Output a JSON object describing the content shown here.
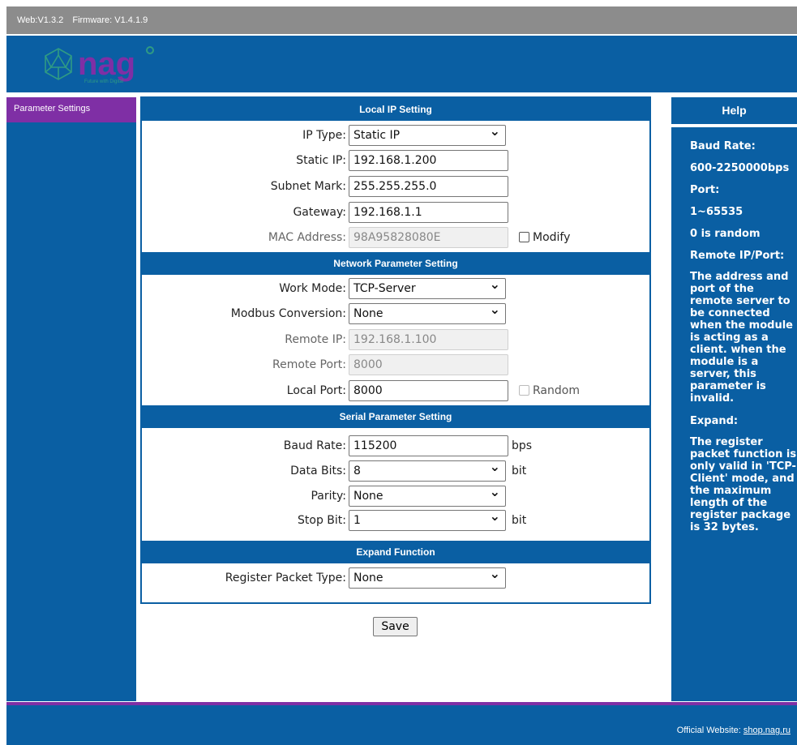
{
  "topbar": {
    "web_version": "Web:V1.3.2",
    "firmware_version": "Firmware: V1.4.1.9"
  },
  "logo": {
    "text": "nag",
    "tagline": "Future with Digital"
  },
  "sidebar": {
    "items": [
      {
        "label": "Parameter Settings"
      }
    ]
  },
  "local_ip": {
    "title": "Local IP Setting",
    "ip_type_label": "IP Type:",
    "ip_type_value": "Static IP",
    "static_ip_label": "Static IP:",
    "static_ip_value": "192.168.1.200",
    "subnet_label": "Subnet Mark:",
    "subnet_value": "255.255.255.0",
    "gateway_label": "Gateway:",
    "gateway_value": "192.168.1.1",
    "mac_label": "MAC Address:",
    "mac_value": "98A95828080E",
    "modify_label": "Modify"
  },
  "network": {
    "title": "Network Parameter Setting",
    "work_mode_label": "Work Mode:",
    "work_mode_value": "TCP-Server",
    "modbus_label": "Modbus Conversion:",
    "modbus_value": "None",
    "remote_ip_label": "Remote IP:",
    "remote_ip_value": "192.168.1.100",
    "remote_port_label": "Remote Port:",
    "remote_port_value": "8000",
    "local_port_label": "Local Port:",
    "local_port_value": "8000",
    "random_label": "Random"
  },
  "serial": {
    "title": "Serial Parameter Setting",
    "baud_label": "Baud Rate:",
    "baud_value": "115200",
    "baud_unit": "bps",
    "data_bits_label": "Data Bits:",
    "data_bits_value": "8",
    "data_bits_unit": "bit",
    "parity_label": "Parity:",
    "parity_value": "None",
    "stop_bit_label": "Stop Bit:",
    "stop_bit_value": "1",
    "stop_bit_unit": "bit"
  },
  "expand": {
    "title": "Expand Function",
    "register_label": "Register Packet Type:",
    "register_value": "None"
  },
  "actions": {
    "save_label": "Save"
  },
  "help": {
    "title": "Help",
    "baud_heading": "Baud Rate:",
    "baud_range": "600-2250000bps",
    "port_heading": "Port:",
    "port_range": "1~65535",
    "port_random": "0 is random",
    "remote_heading": "Remote IP/Port:",
    "remote_text": "The address and port of the remote server to be connected when the module is acting as a client. when the module is a server, this parameter is invalid.",
    "expand_heading": "Expand:",
    "expand_text": "The register packet function is only valid in 'TCP-Client' mode, and the maximum length of the register package is 32 bytes."
  },
  "footer": {
    "label": "Official Website:",
    "link": "shop.nag.ru"
  },
  "colors": {
    "primary_blue": "#0a5fa3",
    "accent_purple": "#7f2fa5",
    "topbar_gray": "#8c8c8c"
  }
}
